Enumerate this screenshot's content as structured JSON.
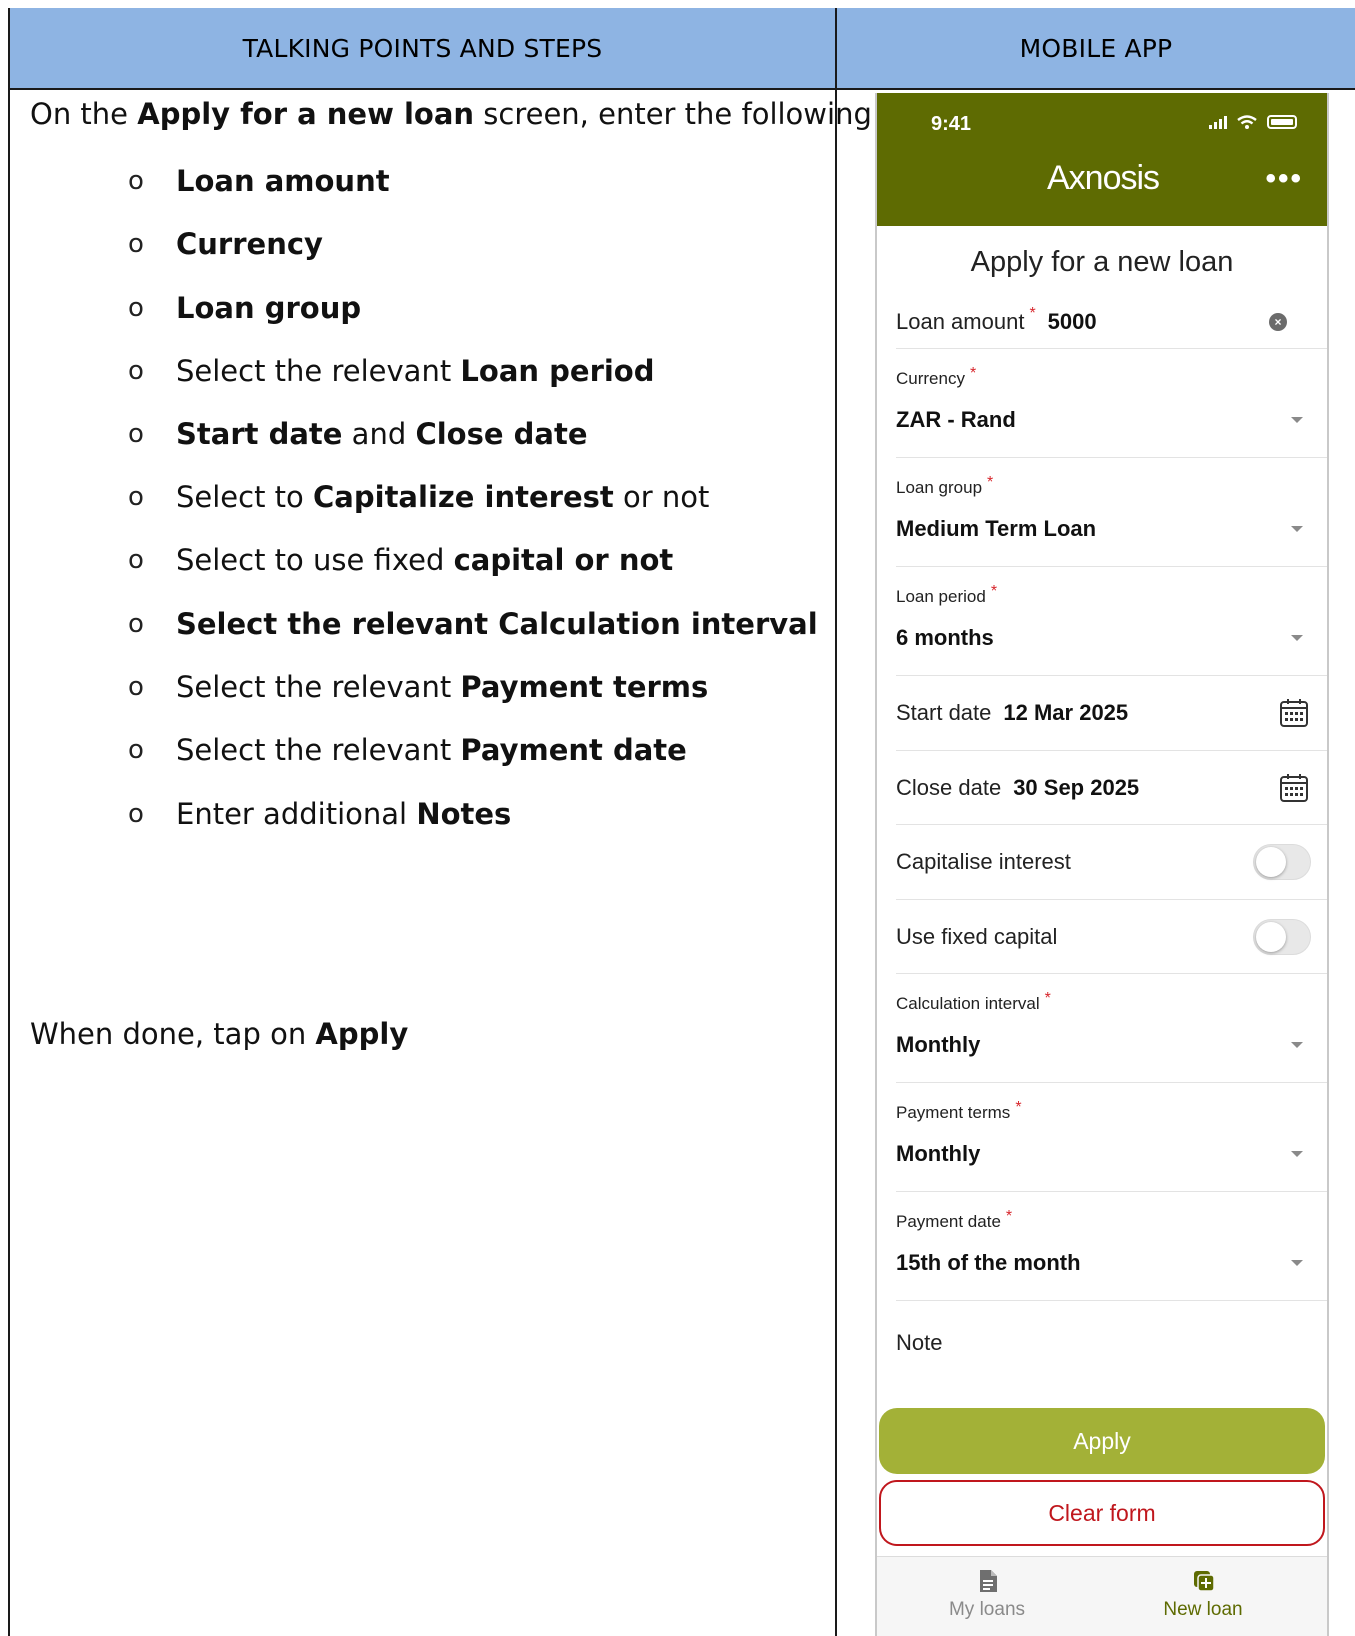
{
  "headers": {
    "left": "TALKING POINTS AND STEPS",
    "right": "MOBILE APP"
  },
  "instructions": {
    "intro": [
      "On the ",
      "Apply for a new loan",
      " screen, enter the following:"
    ],
    "bullet_glyph": "o",
    "steps": [
      [
        {
          "t": "Loan amount",
          "b": true
        }
      ],
      [
        {
          "t": "Currency",
          "b": true
        }
      ],
      [
        {
          "t": "Loan group",
          "b": true
        }
      ],
      [
        {
          "t": "Select the relevant ",
          "b": false
        },
        {
          "t": "Loan period",
          "b": true
        }
      ],
      [
        {
          "t": "Start date",
          "b": true
        },
        {
          "t": " and ",
          "b": false
        },
        {
          "t": "Close date",
          "b": true
        }
      ],
      [
        {
          "t": "Select to ",
          "b": false
        },
        {
          "t": "Capitalize interest",
          "b": true
        },
        {
          "t": " or not",
          "b": false
        }
      ],
      [
        {
          "t": "Select to use fixed ",
          "b": false
        },
        {
          "t": "capital or not",
          "b": true
        }
      ],
      [
        {
          "t": "Select the relevant Calculation interval",
          "b": true
        }
      ],
      [
        {
          "t": "Select the relevant ",
          "b": false
        },
        {
          "t": "Payment terms",
          "b": true
        }
      ],
      [
        {
          "t": "Select the relevant ",
          "b": false
        },
        {
          "t": "Payment date",
          "b": true
        }
      ],
      [
        {
          "t": "Enter additional ",
          "b": false
        },
        {
          "t": "Notes",
          "b": true
        }
      ]
    ],
    "done": [
      "When done, tap on ",
      "Apply"
    ]
  },
  "app": {
    "status_time": "9:41",
    "brand": "Axnosis",
    "more_icon": "ellipsis-icon",
    "page_title": "Apply for a new loan",
    "loan_amount": {
      "label": "Loan amount",
      "value": "5000"
    },
    "currency": {
      "label": "Currency",
      "value": "ZAR - Rand"
    },
    "loan_group": {
      "label": "Loan group",
      "value": "Medium Term Loan"
    },
    "loan_period": {
      "label": "Loan period",
      "value": "6 months"
    },
    "start_date": {
      "label": "Start date",
      "value": "12 Mar 2025"
    },
    "close_date": {
      "label": "Close date",
      "value": "30 Sep 2025"
    },
    "capitalise_interest": {
      "label": "Capitalise interest",
      "on": false
    },
    "fixed_capital": {
      "label": "Use fixed capital",
      "on": false
    },
    "calculation_interval": {
      "label": "Calculation interval",
      "value": "Monthly"
    },
    "payment_terms": {
      "label": "Payment terms",
      "value": "Monthly"
    },
    "payment_date": {
      "label": "Payment date",
      "value": "15th of the month"
    },
    "note": {
      "label": "Note"
    },
    "required_mark": "*",
    "clear_glyph": "×",
    "apply_label": "Apply",
    "clear_label": "Clear form",
    "tabs": [
      {
        "label": "My loans",
        "icon": "document-icon",
        "color": "#8a8a8a"
      },
      {
        "label": "New loan",
        "icon": "add-icon",
        "color": "#5e6b02"
      }
    ],
    "colors": {
      "header_bar": "#5e6b02",
      "apply_button": "#a3b137",
      "clear_button": "#c0171d",
      "required": "#d7262c",
      "table_header": "#8eb4e3"
    }
  }
}
